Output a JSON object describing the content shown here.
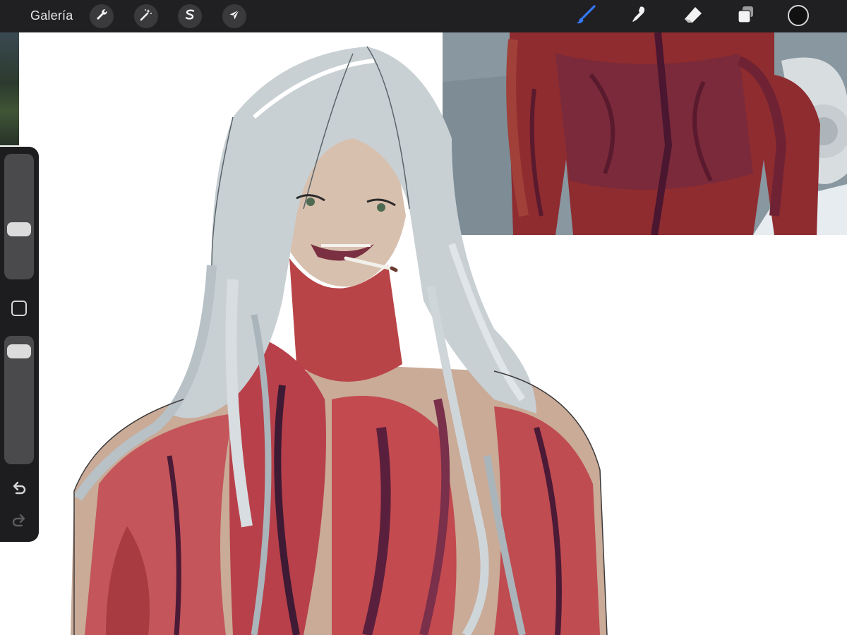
{
  "toolbar": {
    "gallery_label": "Galería",
    "left_tools": [
      {
        "name": "actions",
        "icon": "wrench-icon"
      },
      {
        "name": "adjustments",
        "icon": "magic-wand-icon"
      },
      {
        "name": "selection",
        "icon": "selection-s-icon"
      },
      {
        "name": "transform",
        "icon": "arrow-cursor-icon"
      }
    ],
    "right_tools": [
      {
        "name": "brush",
        "icon": "brush-icon",
        "active": true
      },
      {
        "name": "smudge",
        "icon": "smudge-icon",
        "active": false
      },
      {
        "name": "eraser",
        "icon": "eraser-icon",
        "active": false
      },
      {
        "name": "layers",
        "icon": "layers-icon",
        "active": false
      }
    ],
    "current_color": "#111111",
    "active_tool_color": "#3478f6"
  },
  "sidebar": {
    "brush_size_level": 0.38,
    "opacity_level": 0.95,
    "modifier_icon": "square-modifier-icon",
    "undo_icon": "undo-icon",
    "redo_icon": "redo-icon"
  },
  "canvas": {
    "background": "#ffffff",
    "artwork": "illustration-figure",
    "reference": "reference-photo"
  }
}
